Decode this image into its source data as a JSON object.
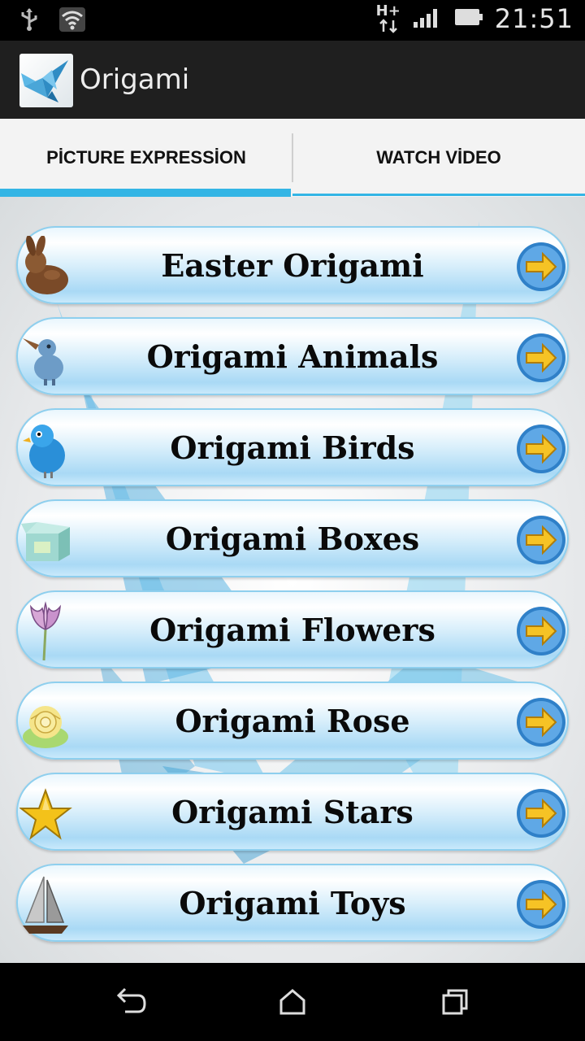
{
  "status_bar": {
    "time": "21:51",
    "network_type": "H+",
    "icons": [
      "usb-icon",
      "wifi-icon",
      "signal-icon",
      "battery-icon"
    ]
  },
  "action_bar": {
    "title": "Origami",
    "icon": "origami-crane-icon"
  },
  "tabs": [
    {
      "label": "PİCTURE EXPRESSİON",
      "selected": true
    },
    {
      "label": "WATCH VİDEO",
      "selected": false
    }
  ],
  "menu": {
    "items": [
      {
        "label": "Easter Origami",
        "icon": "rabbit-icon"
      },
      {
        "label": "Origami Animals",
        "icon": "bird-animal-icon"
      },
      {
        "label": "Origami Birds",
        "icon": "blue-bird-icon"
      },
      {
        "label": "Origami Boxes",
        "icon": "box-icon"
      },
      {
        "label": "Origami Flowers",
        "icon": "flower-icon"
      },
      {
        "label": "Origami Rose",
        "icon": "rose-icon"
      },
      {
        "label": "Origami Stars",
        "icon": "star-icon"
      },
      {
        "label": "Origami Toys",
        "icon": "sailboat-icon"
      }
    ]
  },
  "nav_bar": {
    "buttons": [
      "back-icon",
      "home-icon",
      "recents-icon"
    ]
  },
  "colors": {
    "accent": "#33b5e5",
    "action_bar": "#1f1f1f"
  }
}
